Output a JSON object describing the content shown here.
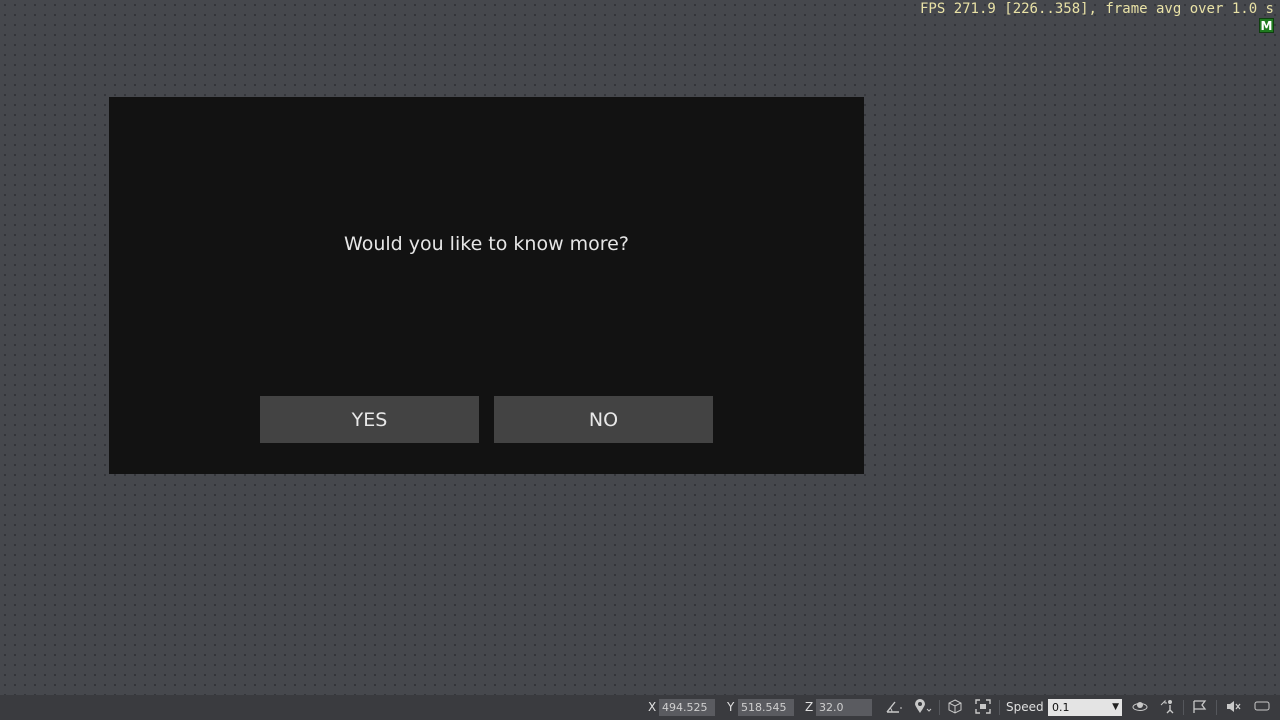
{
  "overlay": {
    "fps_text": "FPS 271.9 [226..358], frame avg over 1.0 s",
    "badge_label": "M"
  },
  "dialog": {
    "prompt": "Would you like to know more?",
    "yes_label": "YES",
    "no_label": "NO"
  },
  "statusbar": {
    "x_label": "X",
    "x_value": "494.525",
    "y_label": "Y",
    "y_value": "518.545",
    "z_label": "Z",
    "z_value": "32.0",
    "speed_label": "Speed",
    "speed_value": "0.1",
    "icons": [
      "angle-tool-icon",
      "location-pin-icon",
      "cube-icon",
      "fit-view-icon",
      "orbit-icon",
      "move-agent-icon",
      "flag-icon",
      "mute-icon",
      "chat-icon"
    ]
  },
  "colors": {
    "background": "#46484d",
    "dialog_bg": "#121212",
    "button_bg": "#434343",
    "fps_text": "#e9e2a6",
    "badge": "#1f7a1f"
  }
}
